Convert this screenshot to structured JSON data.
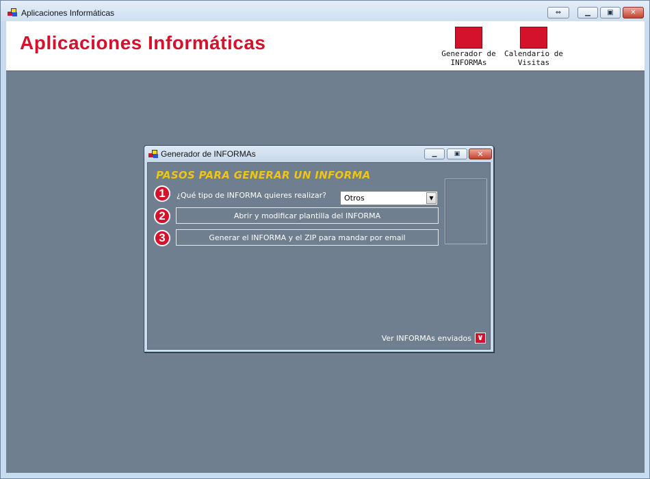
{
  "window": {
    "title": "Aplicaciones Informáticas",
    "controls": {
      "restore_alt": "⇔",
      "minimize": "▁",
      "maximize": "▣",
      "close": "✕"
    }
  },
  "header": {
    "app_title": "Aplicaciones Informáticas",
    "shortcuts": [
      {
        "label": "Generador de\nINFORMAs"
      },
      {
        "label": "Calendario de\nVisitas"
      }
    ]
  },
  "dialog": {
    "title": "Generador de INFORMAs",
    "controls": {
      "minimize": "▁",
      "maximize": "▣",
      "close": "✕"
    },
    "steps_title": "PASOS PARA GENERAR UN INFORMA",
    "steps": [
      {
        "number": "1",
        "question": "¿Qué tipo de INFORMA quieres realizar?"
      },
      {
        "number": "2",
        "button_label": "Abrir y modificar plantilla del INFORMA"
      },
      {
        "number": "3",
        "button_label": "Generar el INFORMA y el ZIP para mandar por email"
      }
    ],
    "type_combo": {
      "selected": "Otros",
      "arrow": "▼"
    },
    "ver_enviados": {
      "label": "Ver INFORMAs enviados",
      "chevron": "∨"
    }
  },
  "colors": {
    "brand_red": "#d4122c",
    "steps_yellow": "#f2c414",
    "mdi_bg": "#6f7f8f"
  }
}
